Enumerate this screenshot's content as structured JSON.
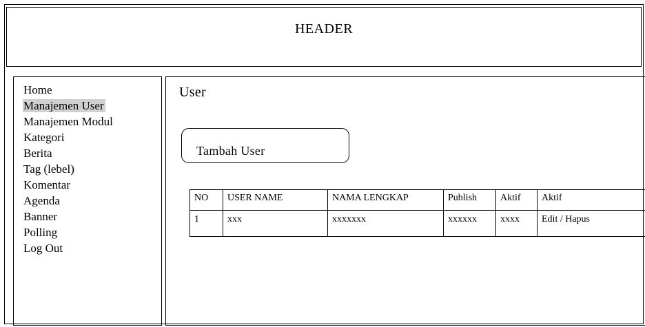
{
  "header": {
    "title": "HEADER"
  },
  "sidebar": {
    "active_index": 1,
    "items": [
      {
        "label": "Home"
      },
      {
        "label": "Manajemen User"
      },
      {
        "label": "Manajemen Modul"
      },
      {
        "label": "Kategori"
      },
      {
        "label": "Berita"
      },
      {
        "label": "Tag (lebel)"
      },
      {
        "label": "Komentar"
      },
      {
        "label": "Agenda"
      },
      {
        "label": "Banner"
      },
      {
        "label": "Polling"
      },
      {
        "label": "Log Out"
      }
    ]
  },
  "main": {
    "title": "User",
    "add_button_label": "Tambah User",
    "table": {
      "headers": [
        "NO",
        "USER NAME",
        "NAMA LENGKAP",
        "Publish",
        "Aktif",
        "Aktif"
      ],
      "rows": [
        {
          "no": "1",
          "username": "xxx",
          "nama_lengkap": "xxxxxxx",
          "publish": "xxxxxx",
          "aktif": "xxxx",
          "action": "Edit / Hapus"
        }
      ]
    }
  },
  "colors": {
    "border": "#000000",
    "active_highlight": "#d0d0d0",
    "background": "#ffffff"
  }
}
